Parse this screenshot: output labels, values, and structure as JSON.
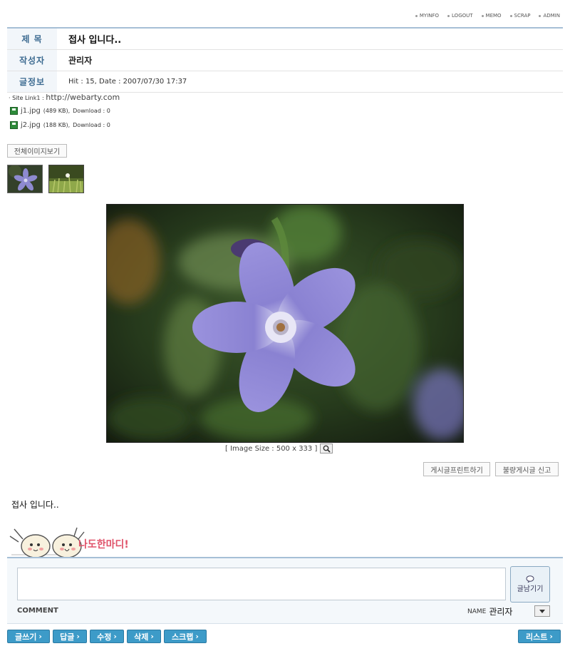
{
  "topmenu": [
    "MYINFO",
    "LOGOUT",
    "MEMO",
    "SCRAP",
    "ADMIN"
  ],
  "post": {
    "subject_label": "제 목",
    "subject": "접사 입니다..",
    "writer_label": "작성자",
    "writer": "관리자",
    "info_label": "글정보",
    "info": "Hit : 15, Date : 2007/07/30 17:37"
  },
  "sitelink": {
    "label": "· Site Link1 :",
    "url": "http://webarty.com"
  },
  "files": [
    {
      "name": "j1.jpg",
      "size": "(489 KB),",
      "download": "Download : 0"
    },
    {
      "name": "j2.jpg",
      "size": "(188 KB),",
      "download": "Download : 0"
    }
  ],
  "view_all_images": "전체이미지보기",
  "image_size": "[ Image Size : 500 x 333 ]",
  "print_button": "게시글프린트하기",
  "report_button": "불량게시글 신고",
  "body_text": "접사 입니다..",
  "mascot_text": "나도한마디!",
  "comment": {
    "submit": "글남기기",
    "label": "COMMENT",
    "name_label": "NAME",
    "name_value": "관리자"
  },
  "buttons": {
    "write": "글쓰기",
    "reply": "답글",
    "edit": "수정",
    "delete": "삭제",
    "scrap": "스크랩",
    "list": "리스트"
  },
  "colors": {
    "accent": "#3d9bc8",
    "label_text": "#3d6b91",
    "table_border": "#a6bfd6"
  }
}
